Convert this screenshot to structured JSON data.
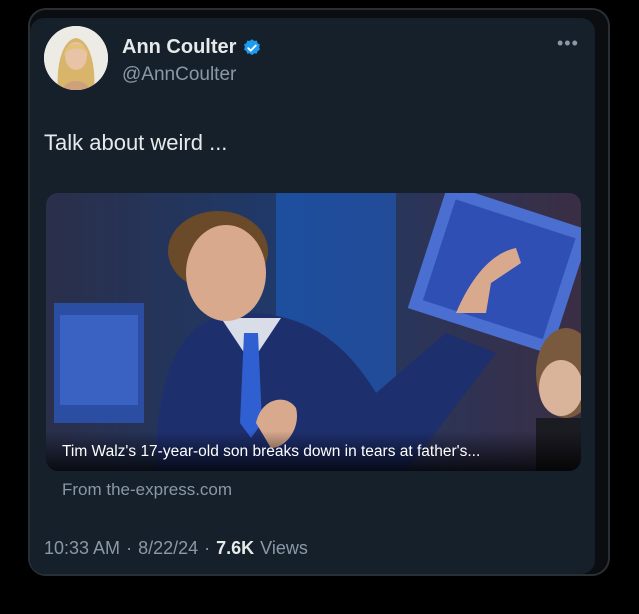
{
  "author": {
    "display_name": "Ann Coulter",
    "handle": "@AnnCoulter",
    "verified_icon": "verified-badge-icon",
    "avatar": "profile-avatar"
  },
  "tweet": {
    "text": "Talk about weird ...",
    "link_card": {
      "caption": "Tim Walz's 17-year-old son breaks down in tears at father's...",
      "source": "From the-express.com"
    },
    "timestamp": "10:33 AM",
    "date": "8/22/24",
    "separator": "·",
    "views_count": "7.6K",
    "views_label": "Views"
  },
  "colors": {
    "background": "#15202b",
    "accent_verified": "#1d9bf0",
    "text_primary": "#e7e9ea",
    "text_secondary": "#8b98a5"
  }
}
